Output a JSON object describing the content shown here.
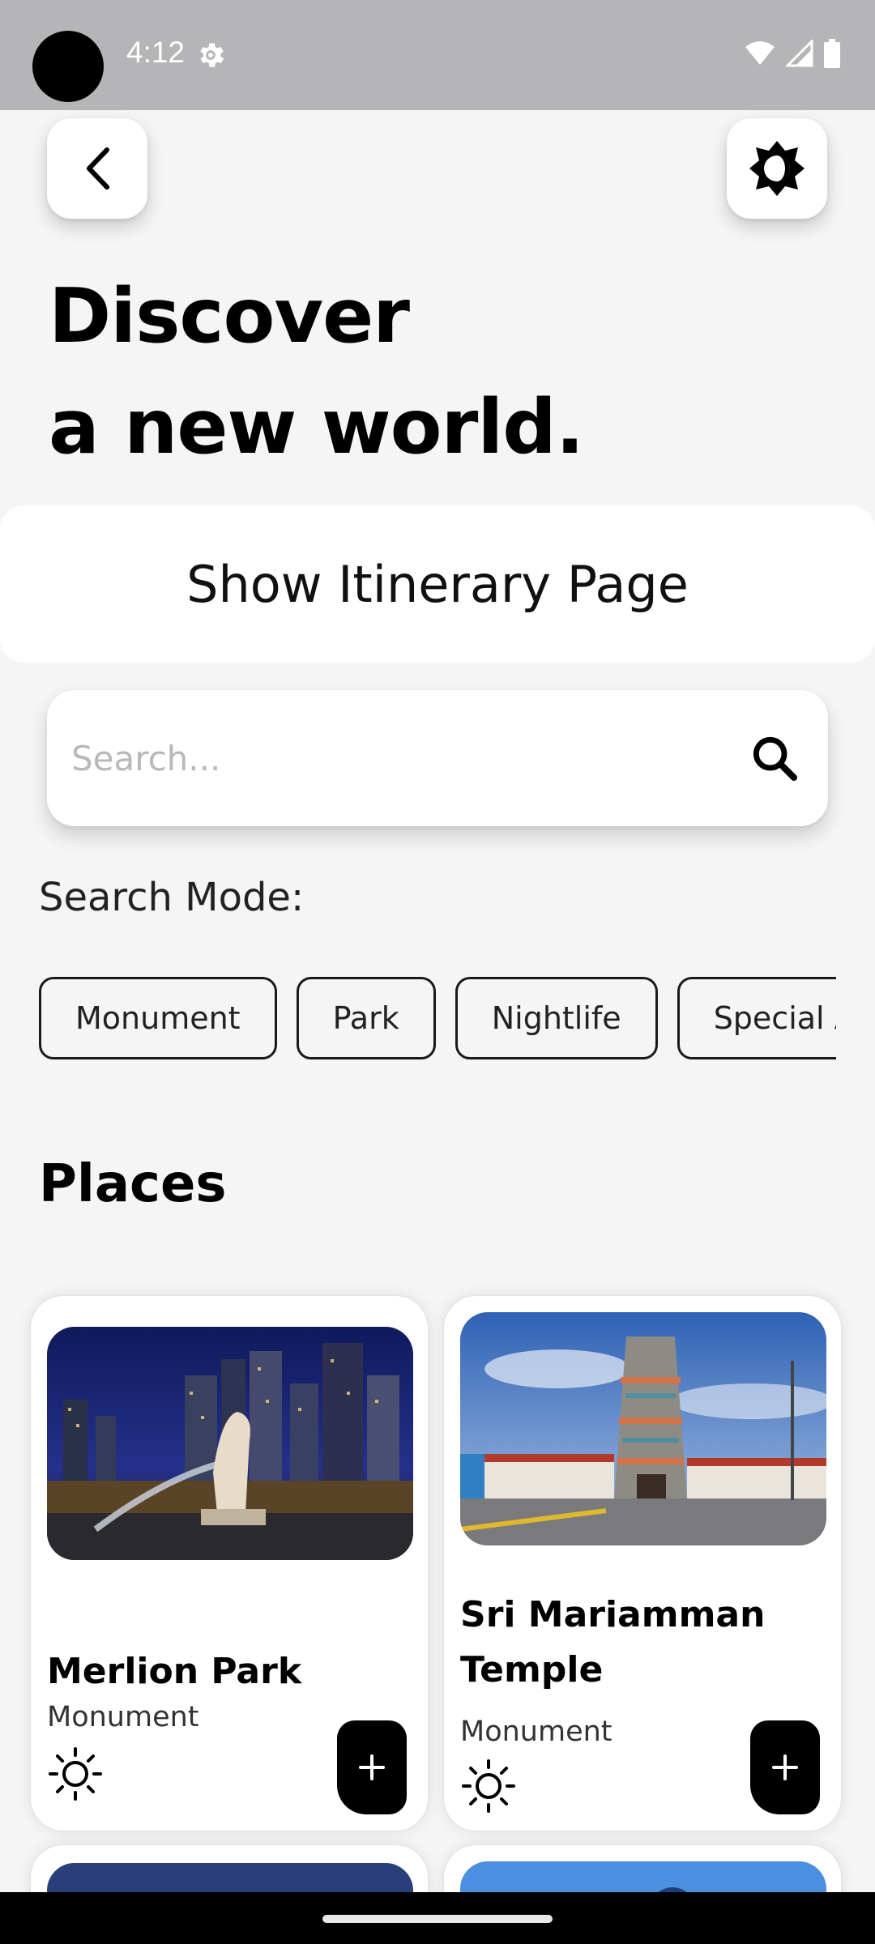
{
  "status_bar": {
    "time": "4:12"
  },
  "header": {
    "title_line1": "Discover",
    "title_line2": "a new world."
  },
  "itinerary": {
    "label": "Show Itinerary Page"
  },
  "search": {
    "placeholder": "Search...",
    "value": ""
  },
  "search_mode": {
    "label": "Search Mode:",
    "chips": [
      "Monument",
      "Park",
      "Nightlife",
      "Special Attractions"
    ]
  },
  "places": {
    "title": "Places",
    "cards": [
      {
        "name": "Merlion Park",
        "category": "Monument"
      },
      {
        "name": "Sri Mariamman Temple",
        "category": "Monument"
      }
    ]
  }
}
